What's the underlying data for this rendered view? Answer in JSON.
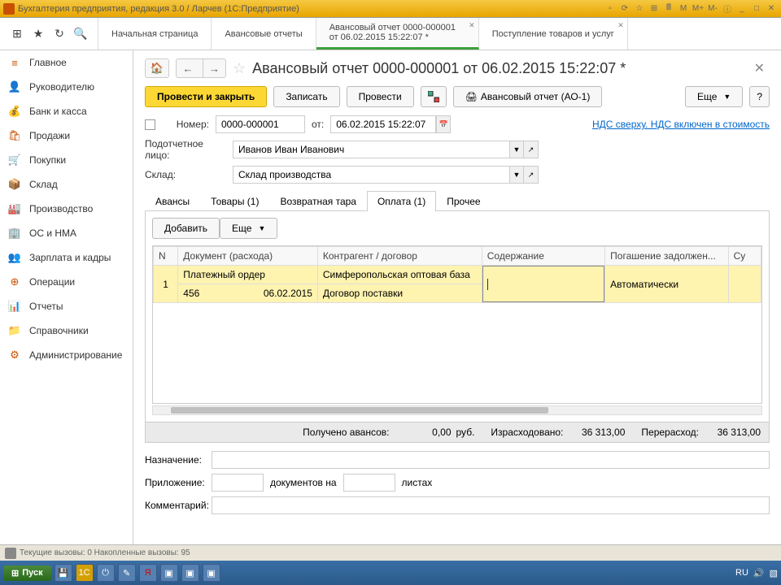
{
  "titlebar": {
    "title": "Бухгалтерия предприятия, редакция 3.0 / Ларчев  (1С:Предприятие)"
  },
  "top_tabs": [
    {
      "label": "Начальная страница"
    },
    {
      "label": "Авансовые отчеты"
    },
    {
      "label": "Авансовый отчет 0000-000001 от 06.02.2015 15:22:07 *",
      "active": true,
      "closeable": true
    },
    {
      "label": "Поступление товаров и услуг",
      "closeable": true
    }
  ],
  "sidebar": [
    {
      "icon": "≡",
      "label": "Главное"
    },
    {
      "icon": "👤",
      "label": "Руководителю"
    },
    {
      "icon": "💰",
      "label": "Банк и касса"
    },
    {
      "icon": "🛍",
      "label": "Продажи"
    },
    {
      "icon": "🛒",
      "label": "Покупки"
    },
    {
      "icon": "📦",
      "label": "Склад"
    },
    {
      "icon": "🏭",
      "label": "Производство"
    },
    {
      "icon": "🏢",
      "label": "ОС и НМА"
    },
    {
      "icon": "👥",
      "label": "Зарплата и кадры"
    },
    {
      "icon": "⊕",
      "label": "Операции"
    },
    {
      "icon": "📊",
      "label": "Отчеты"
    },
    {
      "icon": "📁",
      "label": "Справочники"
    },
    {
      "icon": "⚙",
      "label": "Администрирование"
    }
  ],
  "document": {
    "title": "Авансовый отчет 0000-000001 от 06.02.2015 15:22:07 *",
    "toolbar": {
      "post_close": "Провести и закрыть",
      "save": "Записать",
      "post": "Провести",
      "print": "Авансовый отчет (АО-1)",
      "more": "Еще"
    },
    "number_label": "Номер:",
    "number": "0000-000001",
    "date_label": "от:",
    "date": "06.02.2015 15:22:07",
    "nds_link": "НДС сверху. НДС включен в стоимость",
    "person_label": "Подотчетное лицо:",
    "person": "Иванов Иван Иванович",
    "warehouse_label": "Склад:",
    "warehouse": "Склад производства",
    "inner_tabs": [
      {
        "label": "Авансы"
      },
      {
        "label": "Товары (1)"
      },
      {
        "label": "Возвратная тара"
      },
      {
        "label": "Оплата (1)",
        "active": true
      },
      {
        "label": "Прочее"
      }
    ],
    "grid": {
      "add_btn": "Добавить",
      "more_btn": "Еще",
      "columns": [
        "N",
        "Документ (расхода)",
        "Контрагент / договор",
        "Содержание",
        "Погашение задолжен...",
        "Су"
      ],
      "rows": [
        {
          "n": "1",
          "doc1": "Платежный ордер",
          "doc_num": "456",
          "doc_date": "06.02.2015",
          "counterparty": "Симферопольская оптовая база",
          "contract": "Договор поставки",
          "content": "",
          "payoff": "Автоматически"
        }
      ]
    },
    "totals": {
      "received_label": "Получено авансов:",
      "received": "0,00",
      "currency": "руб.",
      "spent_label": "Израсходовано:",
      "spent": "36 313,00",
      "over_label": "Перерасход:",
      "over": "36 313,00"
    },
    "bottom": {
      "purpose_label": "Назначение:",
      "attach_label": "Приложение:",
      "attach_mid": "документов на",
      "attach_end": "листах",
      "comment_label": "Комментарий:"
    }
  },
  "statusbar": {
    "text": "Текущие вызовы: 0  Накопленные вызовы: 95"
  },
  "taskbar": {
    "start": "Пуск",
    "lang": "RU"
  }
}
